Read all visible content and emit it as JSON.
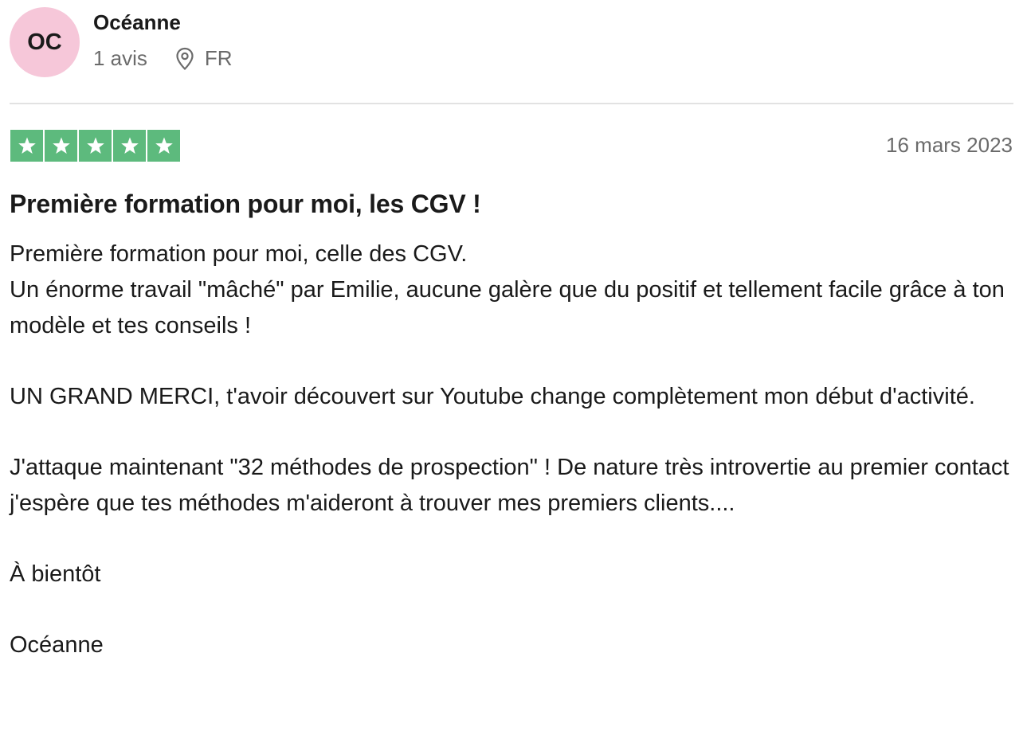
{
  "reviewer": {
    "initials": "OC",
    "name": "Océanne",
    "review_count": "1 avis",
    "country": "FR",
    "avatar_color": "#f6c7d9"
  },
  "review": {
    "rating": 5,
    "rating_max": 5,
    "star_color": "#5dba7d",
    "date": "16 mars 2023",
    "title": "Première formation pour moi, les CGV !",
    "paragraphs": [
      "Première formation pour moi, celle des CGV.\nUn énorme travail \"mâché\" par Emilie, aucune galère que du positif et tellement facile grâce à ton modèle et tes conseils !",
      "UN GRAND MERCI, t'avoir découvert sur Youtube change complètement mon début d'activité.",
      "J'attaque maintenant \"32 méthodes de prospection\" ! De nature très introvertie au premier contact j'espère que tes méthodes m'aideront à trouver mes premiers clients....",
      "À bientôt",
      "Océanne"
    ]
  },
  "icons": {
    "location": "map-pin-icon",
    "star": "star-icon"
  }
}
